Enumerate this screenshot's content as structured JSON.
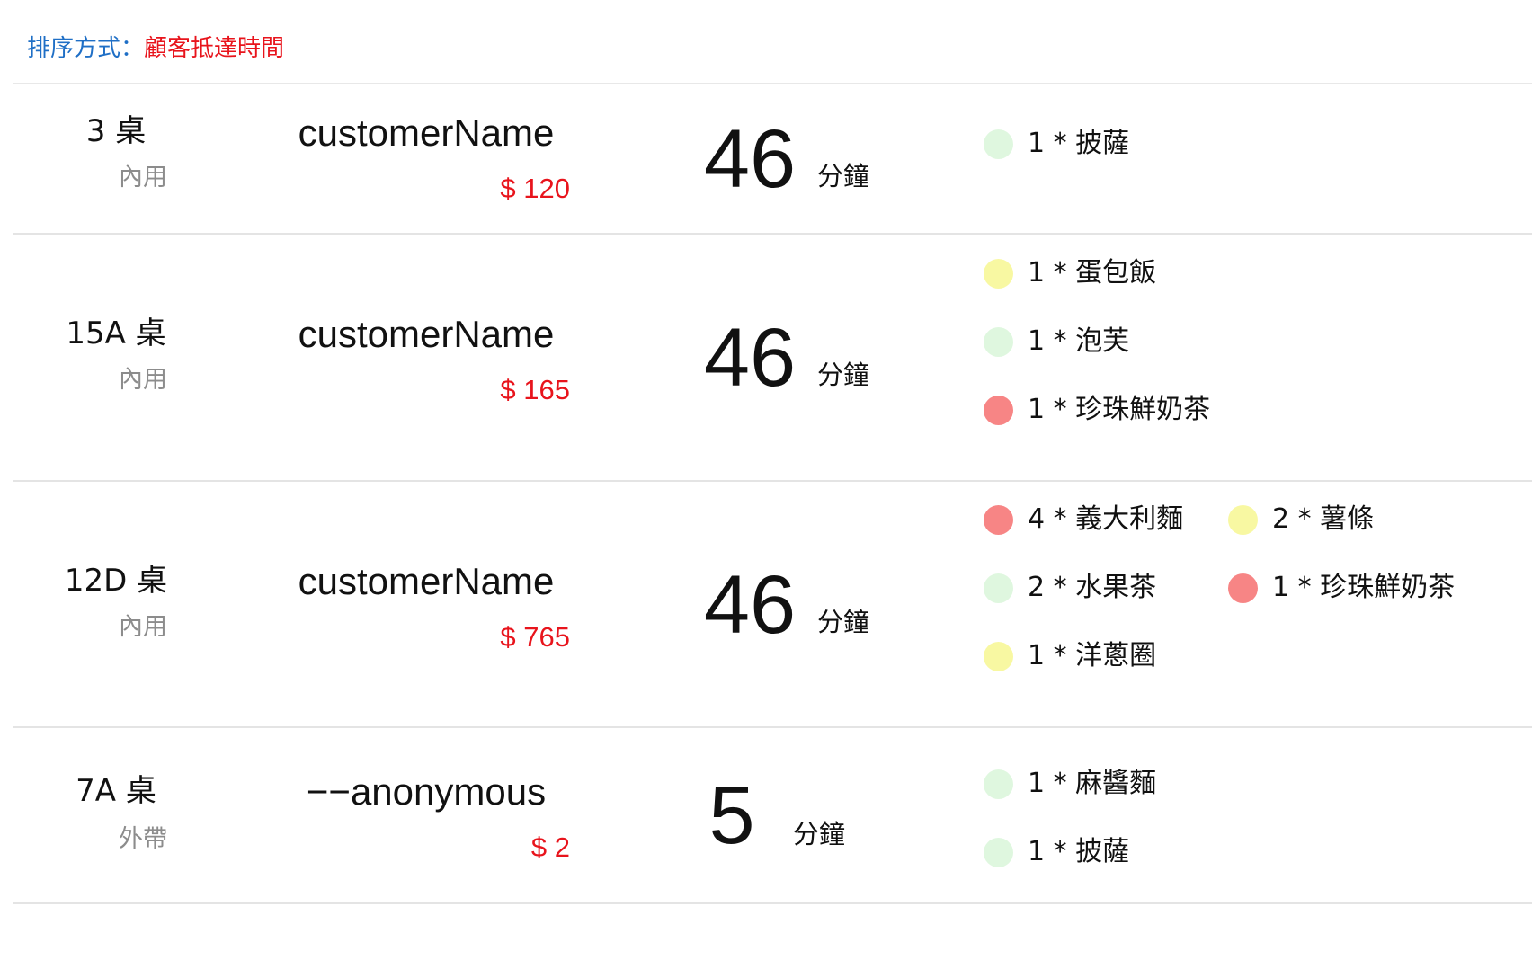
{
  "sort": {
    "label": "排序方式：",
    "value": "顧客抵達時間"
  },
  "status_colors": {
    "green": "#dff7df",
    "yellow": "#f8f8a2",
    "red": "#f78585"
  },
  "orders": [
    {
      "table": "3 桌",
      "type": "內用",
      "customer": "customerName",
      "price": "$ 120",
      "minutes": "46",
      "unit": "分鐘",
      "items": [
        {
          "text": "1 *  披薩",
          "status": "green"
        }
      ]
    },
    {
      "table": "15A 桌",
      "type": "內用",
      "customer": "customerName",
      "price": "$ 165",
      "minutes": "46",
      "unit": "分鐘",
      "items": [
        {
          "text": "1 *  蛋包飯",
          "status": "yellow"
        },
        {
          "text": "1 *  泡芙",
          "status": "green"
        },
        {
          "text": "1 *  珍珠鮮奶茶",
          "status": "red"
        }
      ]
    },
    {
      "table": "12D 桌",
      "type": "內用",
      "customer": "customerName",
      "price": "$ 765",
      "minutes": "46",
      "unit": "分鐘",
      "items": [
        {
          "text": "4 *  義大利麵",
          "status": "red"
        },
        {
          "text": "2 *  薯條",
          "status": "yellow"
        },
        {
          "text": "2 *  水果茶",
          "status": "green"
        },
        {
          "text": "1 *  珍珠鮮奶茶",
          "status": "red"
        },
        {
          "text": "1 *  洋蔥圈",
          "status": "yellow"
        }
      ]
    },
    {
      "table": "7A 桌",
      "type": "外帶",
      "customer": "−−anonymous",
      "price": "$ 2",
      "minutes": "5",
      "unit": "分鐘",
      "items": [
        {
          "text": "1 *  麻醬麵",
          "status": "green"
        },
        {
          "text": "1 *  披薩",
          "status": "green"
        }
      ]
    }
  ]
}
